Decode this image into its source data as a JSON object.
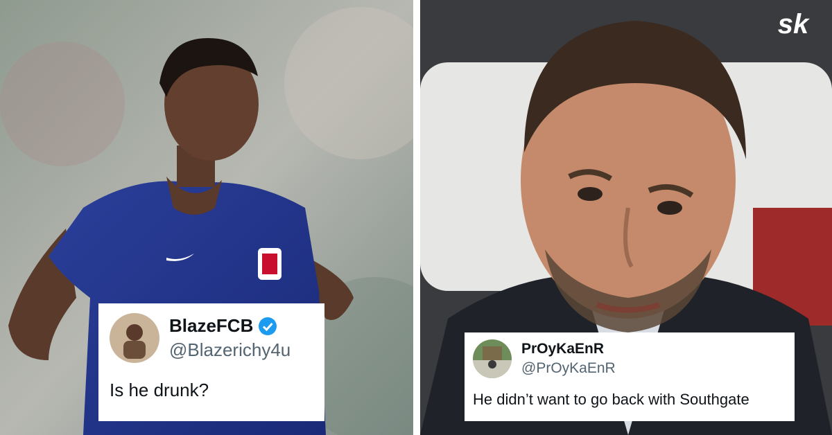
{
  "brand": {
    "logo_text": "sk",
    "logo_color": "#ffffff"
  },
  "tweets": [
    {
      "name": "BlazeFCB",
      "handle": "@Blazerichy4u",
      "verified": true,
      "text": "Is he drunk?"
    },
    {
      "name": "PrOyKaEnR",
      "handle": "@PrOyKaEnR",
      "verified": false,
      "text": "He didn’t want to go back with Southgate"
    }
  ],
  "colors": {
    "verified_badge": "#1d9bf0",
    "handle_gray": "#536471",
    "kit_blue": "#1e3a8a"
  }
}
